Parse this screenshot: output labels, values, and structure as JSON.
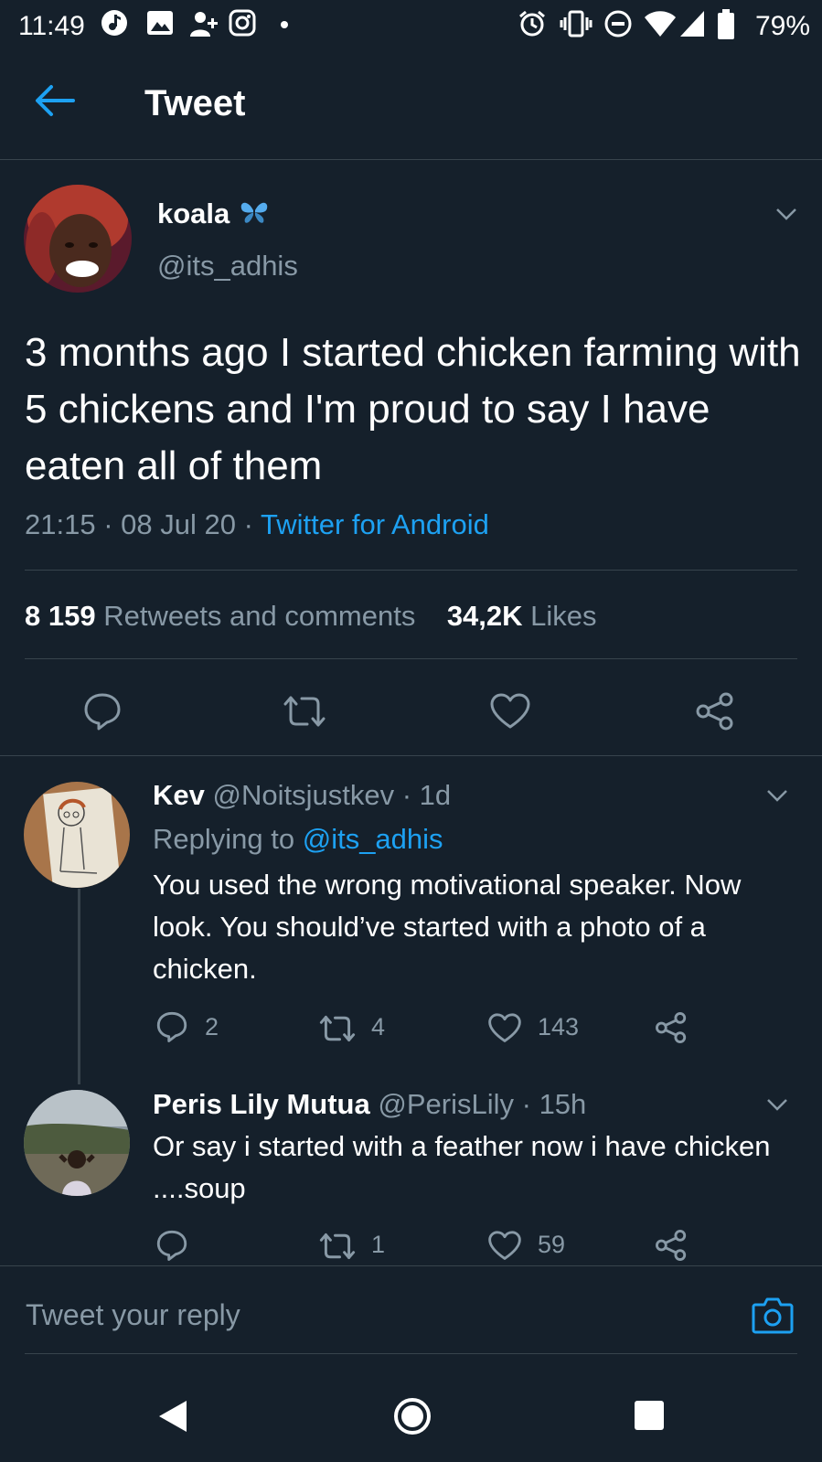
{
  "status_bar": {
    "time": "11:49",
    "battery": "79%"
  },
  "header": {
    "title": "Tweet"
  },
  "tweet": {
    "author_name": "koala",
    "author_handle": "@its_adhis",
    "text": "3 months ago I started chicken farming with 5 chickens and I'm proud to say I have eaten all of them",
    "time": "21:15",
    "date": "08 Jul 20",
    "source": "Twitter for Android",
    "retweets_count": "8 159",
    "retweets_label": "Retweets and comments",
    "likes_count": "34,2K",
    "likes_label": "Likes"
  },
  "replies": [
    {
      "name": "Kev",
      "handle": "@Noitsjustkev",
      "age": "1d",
      "replying_prefix": "Replying to",
      "replying_handle": "@its_adhis",
      "text": "You used the wrong motivational speaker. Now look. You should’ve started with a photo of a chicken.",
      "comments": "2",
      "retweets": "4",
      "likes": "143"
    },
    {
      "name": "Peris Lily Mutua",
      "handle": "@PerisLily",
      "age": "15h",
      "text": "Or say i started with a feather now i have chicken ....soup",
      "comments": "",
      "retweets": "1",
      "likes": "59"
    }
  ],
  "composer": {
    "placeholder": "Tweet your reply"
  },
  "colors": {
    "background": "#15202b",
    "accent": "#1da1f2",
    "muted": "#8899a6",
    "divider": "#38444d"
  }
}
